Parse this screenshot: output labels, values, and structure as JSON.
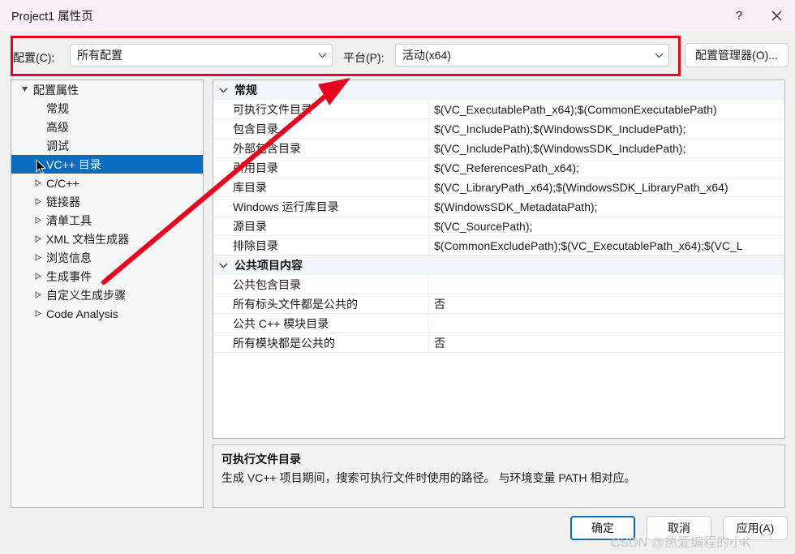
{
  "window": {
    "title": "Project1 属性页",
    "help_icon": "?",
    "close_icon": "close-icon",
    "titlebar_color": "#f9f0f8",
    "body_color": "#f0f0f0"
  },
  "config_row": {
    "config_label": "配置(C):",
    "config_value": "所有配置",
    "platform_label": "平台(P):",
    "platform_value": "活动(x64)",
    "config_manager_button": "配置管理器(O)...",
    "highlight_color": "#e8001d"
  },
  "tree": {
    "selected_color": "#0a6cbc",
    "items": [
      {
        "label": "配置属性",
        "indent": 0,
        "arrow": "expanded",
        "selected": false
      },
      {
        "label": "常规",
        "indent": 1,
        "arrow": "none",
        "selected": false
      },
      {
        "label": "高级",
        "indent": 1,
        "arrow": "none",
        "selected": false
      },
      {
        "label": "调试",
        "indent": 1,
        "arrow": "none",
        "selected": false
      },
      {
        "label": "VC++ 目录",
        "indent": 1,
        "arrow": "none",
        "selected": true
      },
      {
        "label": "C/C++",
        "indent": 1,
        "arrow": "collapsed",
        "selected": false
      },
      {
        "label": "链接器",
        "indent": 1,
        "arrow": "collapsed",
        "selected": false
      },
      {
        "label": "清单工具",
        "indent": 1,
        "arrow": "collapsed",
        "selected": false
      },
      {
        "label": "XML 文档生成器",
        "indent": 1,
        "arrow": "collapsed",
        "selected": false
      },
      {
        "label": "浏览信息",
        "indent": 1,
        "arrow": "collapsed",
        "selected": false
      },
      {
        "label": "生成事件",
        "indent": 1,
        "arrow": "collapsed",
        "selected": false
      },
      {
        "label": "自定义生成步骤",
        "indent": 1,
        "arrow": "collapsed",
        "selected": false
      },
      {
        "label": "Code Analysis",
        "indent": 1,
        "arrow": "collapsed",
        "selected": false
      }
    ]
  },
  "grid": {
    "rows": [
      {
        "type": "category",
        "name": "常规",
        "value": ""
      },
      {
        "type": "prop",
        "name": "可执行文件目录",
        "value": "$(VC_ExecutablePath_x64);$(CommonExecutablePath)"
      },
      {
        "type": "prop",
        "name": "包含目录",
        "value": "$(VC_IncludePath);$(WindowsSDK_IncludePath);"
      },
      {
        "type": "prop",
        "name": "外部包含目录",
        "value": "$(VC_IncludePath);$(WindowsSDK_IncludePath);"
      },
      {
        "type": "prop",
        "name": "引用目录",
        "value": "$(VC_ReferencesPath_x64);"
      },
      {
        "type": "prop",
        "name": "库目录",
        "value": "$(VC_LibraryPath_x64);$(WindowsSDK_LibraryPath_x64)"
      },
      {
        "type": "prop",
        "name": "Windows 运行库目录",
        "value": "$(WindowsSDK_MetadataPath);"
      },
      {
        "type": "prop",
        "name": "源目录",
        "value": "$(VC_SourcePath);"
      },
      {
        "type": "prop",
        "name": "排除目录",
        "value": "$(CommonExcludePath);$(VC_ExecutablePath_x64);$(VC_L"
      },
      {
        "type": "category",
        "name": "公共项目内容",
        "value": ""
      },
      {
        "type": "prop",
        "name": "公共包含目录",
        "value": ""
      },
      {
        "type": "prop",
        "name": "所有标头文件都是公共的",
        "value": "否"
      },
      {
        "type": "prop",
        "name": "公共 C++ 模块目录",
        "value": ""
      },
      {
        "type": "prop",
        "name": "所有模块都是公共的",
        "value": "否"
      }
    ]
  },
  "description": {
    "title": "可执行文件目录",
    "body": "生成 VC++ 项目期间，搜索可执行文件时使用的路径。  与环境变量 PATH 相对应。"
  },
  "footer": {
    "ok_label": "确定",
    "cancel_label": "取消",
    "apply_label": "应用(A)"
  },
  "watermark": {
    "text": "CSDN @热爱编程的小K"
  }
}
